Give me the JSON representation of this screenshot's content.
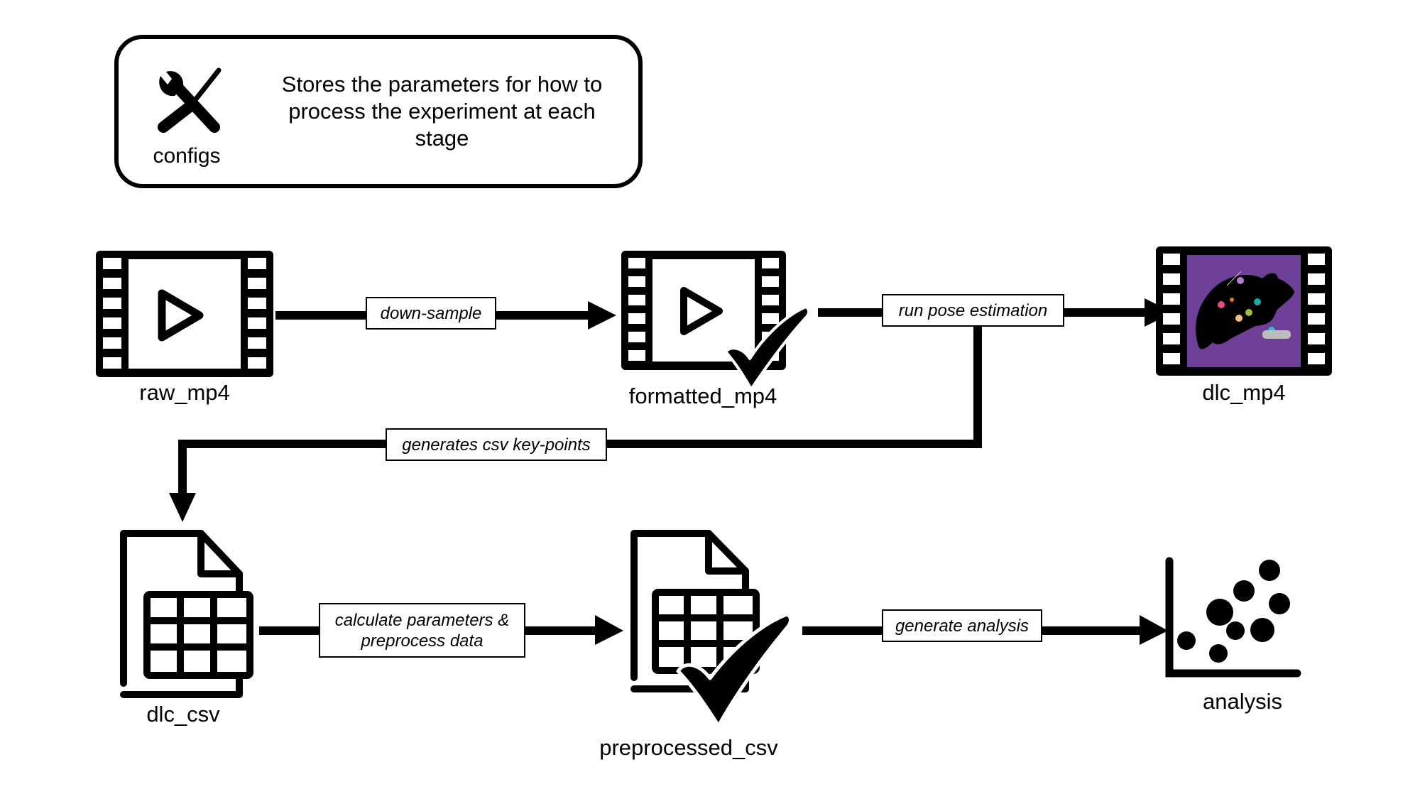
{
  "config": {
    "label": "configs",
    "icon": "tools-icon",
    "description": "Stores the parameters for how to process the experiment at each stage"
  },
  "nodes": {
    "raw_mp4": {
      "label": "raw_mp4",
      "icon": "video-film-icon"
    },
    "formatted_mp4": {
      "label": "formatted_mp4",
      "icon": "video-film-icon",
      "status": "checkmark-icon"
    },
    "dlc_mp4": {
      "label": "dlc_mp4",
      "icon": "pose-video-film-icon",
      "accent": "#6E3F97"
    },
    "dlc_csv": {
      "label": "dlc_csv",
      "icon": "csv-document-icon"
    },
    "preprocessed_csv": {
      "label": "preprocessed_csv",
      "icon": "csv-document-icon",
      "status": "checkmark-icon"
    },
    "analysis": {
      "label": "analysis",
      "icon": "scatter-plot-icon"
    }
  },
  "edges": {
    "down_sample": {
      "label": "down-sample",
      "from": "raw_mp4",
      "to": "formatted_mp4"
    },
    "run_pose_estimation": {
      "label": "run pose estimation",
      "from": "formatted_mp4",
      "to": "dlc_mp4"
    },
    "generates_csv": {
      "label": "generates csv key-points",
      "from": "run_pose_estimation",
      "to": "dlc_csv"
    },
    "calculate_parameters": {
      "label": "calculate parameters & preprocess data",
      "from": "dlc_csv",
      "to": "preprocessed_csv"
    },
    "generate_analysis": {
      "label": "generate analysis",
      "from": "preprocessed_csv",
      "to": "analysis"
    }
  }
}
